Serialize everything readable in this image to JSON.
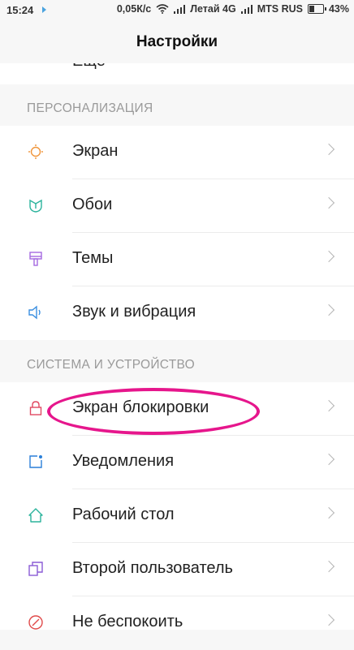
{
  "status_bar": {
    "time": "15:24",
    "speed": "0,05К/с",
    "carrier1": "Летай 4G",
    "carrier2": "MTS RUS",
    "battery": "43%"
  },
  "header": {
    "title": "Настройки"
  },
  "partial_item": {
    "label": "Ещё"
  },
  "sections": {
    "personalization": {
      "title": "ПЕРСОНАЛИЗАЦИЯ"
    },
    "system": {
      "title": "СИСТЕМА И УСТРОЙСТВО"
    }
  },
  "items": [
    {
      "label": "Экран",
      "icon": "display-icon",
      "color": "#f0953a"
    },
    {
      "label": "Обои",
      "icon": "wallpaper-icon",
      "color": "#2bb39c"
    },
    {
      "label": "Темы",
      "icon": "theme-icon",
      "color": "#a56ae0"
    },
    {
      "label": "Звук и вибрация",
      "icon": "sound-icon",
      "color": "#3a8fe0"
    },
    {
      "label": "Экран блокировки",
      "icon": "lock-icon",
      "color": "#e04a62"
    },
    {
      "label": "Уведомления",
      "icon": "notification-icon",
      "color": "#2a7fd9"
    },
    {
      "label": "Рабочий стол",
      "icon": "home-icon",
      "color": "#2bb39c"
    },
    {
      "label": "Второй пользователь",
      "icon": "second-user-icon",
      "color": "#8a5ad6"
    },
    {
      "label": "Не беспокоить",
      "icon": "do-not-disturb-icon",
      "color": "#e04a4a"
    }
  ],
  "colors": {
    "highlight": "#e6168c",
    "background": "#f7f7f7"
  }
}
